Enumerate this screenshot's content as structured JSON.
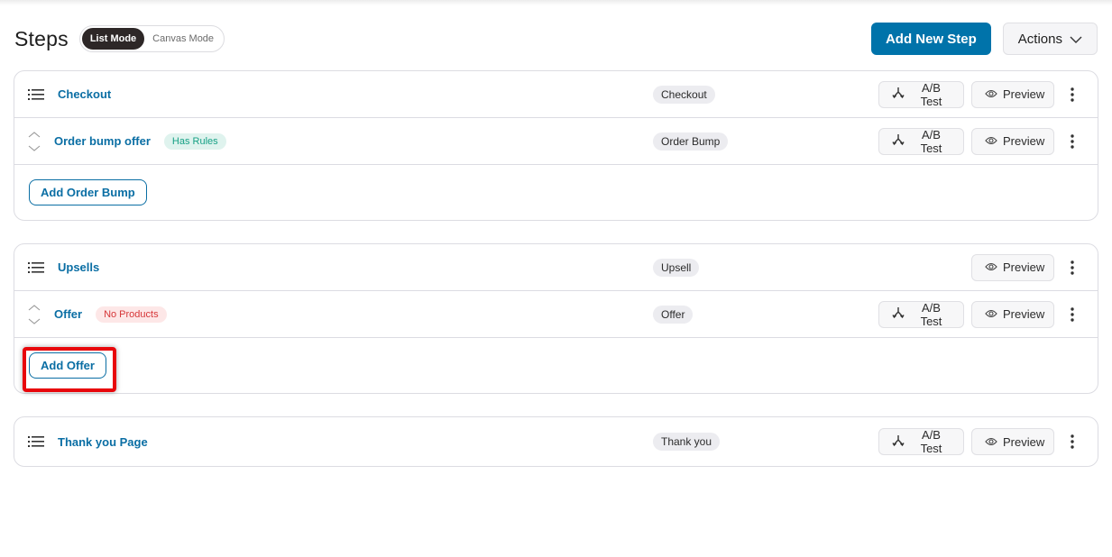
{
  "header": {
    "title": "Steps",
    "modes": [
      "List Mode",
      "Canvas Mode"
    ],
    "active_mode": "List Mode",
    "add_step_label": "Add New Step",
    "actions_label": "Actions"
  },
  "colors": {
    "primary": "#0073aa",
    "link": "#0a6ea4",
    "has_rules_bg": "#dff3ee",
    "has_rules_text": "#16a085",
    "no_products_bg": "#fde7e7",
    "no_products_text": "#d63638",
    "highlight": "#e8060b"
  },
  "common": {
    "ab_test_label": "A/B Test",
    "preview_label": "Preview"
  },
  "groups": [
    {
      "main": {
        "name": "Checkout",
        "type": "Checkout",
        "ab_test": true
      },
      "sub": {
        "name": "Order bump offer",
        "badge": "Has Rules",
        "type": "Order Bump",
        "ab_test": true
      },
      "add_label": "Add Order Bump"
    },
    {
      "main": {
        "name": "Upsells",
        "type": "Upsell",
        "ab_test": false
      },
      "sub": {
        "name": "Offer",
        "badge": "No Products",
        "type": "Offer",
        "ab_test": true
      },
      "add_label": "Add Offer",
      "highlighted": true
    },
    {
      "main": {
        "name": "Thank you Page",
        "type": "Thank you",
        "ab_test": true
      }
    }
  ]
}
